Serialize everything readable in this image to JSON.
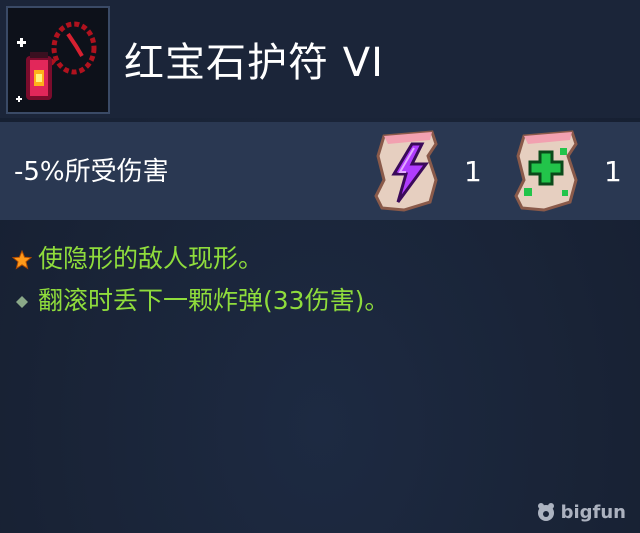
{
  "item": {
    "icon": "ruby-amulet-icon",
    "title": "红宝石护符 VI"
  },
  "stats": {
    "modifier": "-5%所受伤害"
  },
  "scrolls": [
    {
      "icon": "brutality-scroll-icon",
      "color": "#b03cff",
      "count": "1"
    },
    {
      "icon": "survival-scroll-icon",
      "color": "#22c44a",
      "count": "1"
    }
  ],
  "effects": [
    {
      "bullet": "star-icon",
      "text": "使隐形的敌人现形。"
    },
    {
      "bullet": "diamond-bullet-icon",
      "text": "翻滚时丢下一颗炸弹(33伤害)。"
    }
  ],
  "colors": {
    "effect_text": "#8fdc3c",
    "header_bg": "#1b2539",
    "stat_bg": "#2a3852"
  },
  "watermark": {
    "icon": "bigfun-logo-icon",
    "text": "bigfun"
  }
}
